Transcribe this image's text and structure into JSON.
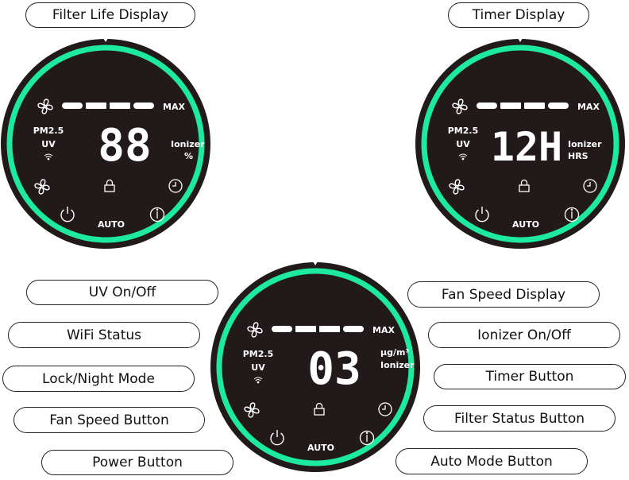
{
  "colors": {
    "ring": "#1de9a0",
    "panel": "#221a1a",
    "segment": "#ffffff"
  },
  "labels": [
    {
      "id": "filter-life-display",
      "text": "Filter Life Display"
    },
    {
      "id": "timer-display",
      "text": "Timer Display"
    },
    {
      "id": "uv-on-off",
      "text": "UV On/Off"
    },
    {
      "id": "wifi-status",
      "text": "WiFi Status"
    },
    {
      "id": "lock-night-mode",
      "text": "Lock/Night Mode"
    },
    {
      "id": "fan-speed-button",
      "text": "Fan Speed Button"
    },
    {
      "id": "power-button",
      "text": "Power Button"
    },
    {
      "id": "fan-speed-display",
      "text": "Fan Speed Display"
    },
    {
      "id": "ionizer-on-off",
      "text": "Ionizer On/Off"
    },
    {
      "id": "timer-button",
      "text": "Timer Button"
    },
    {
      "id": "filter-status-button",
      "text": "Filter Status Button"
    },
    {
      "id": "auto-mode-button",
      "text": "Auto Mode Button"
    }
  ],
  "panels": [
    {
      "id": "filter-life",
      "digits": "88",
      "max": "MAX",
      "pm": "PM2.5",
      "uv": "UV",
      "right_top": "Ionizer",
      "right_bottom": "%",
      "auto": "AUTO",
      "fan_bars": 4
    },
    {
      "id": "timer",
      "digits": "12H",
      "max": "MAX",
      "pm": "PM2.5",
      "uv": "UV",
      "right_top": "Ionizer",
      "right_bottom": "HRS",
      "auto": "AUTO",
      "fan_bars": 4
    },
    {
      "id": "pm25",
      "digits": "03",
      "max": "MAX",
      "pm": "PM2.5",
      "uv": "UV",
      "right_top": "µg/m³",
      "right_bottom": "Ionizer",
      "auto": "AUTO",
      "fan_bars": 4
    }
  ],
  "icons": [
    "fan-icon",
    "wifi-icon",
    "lock-icon",
    "timer-icon",
    "power-icon",
    "info-icon"
  ]
}
